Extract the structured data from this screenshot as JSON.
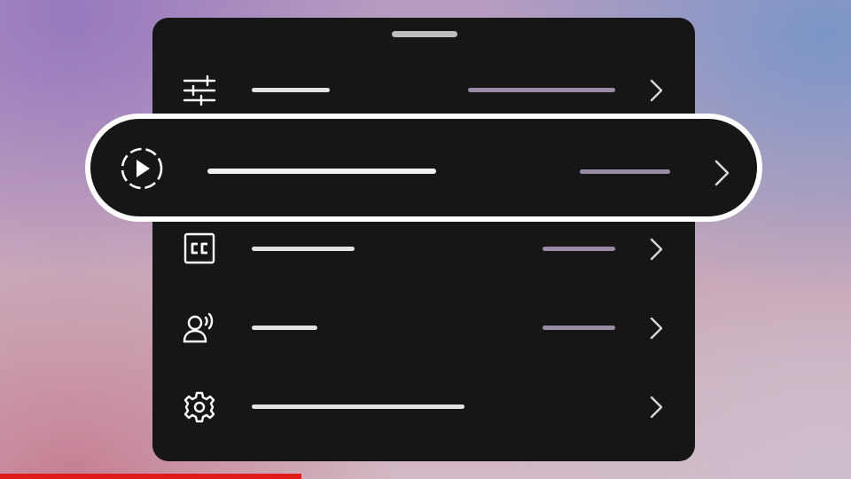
{
  "menu": {
    "colors": {
      "panel": "#161616",
      "label_bar": "#e2e2e2",
      "value_bar": "#9a8aa6",
      "icon": "#ffffff",
      "highlight_border": "#ffffff"
    },
    "items": [
      {
        "icon": "sliders-icon"
      },
      {
        "icon": "play-circle-dashed-icon",
        "selected": true
      },
      {
        "icon": "closed-captions-icon"
      },
      {
        "icon": "voice-speaker-icon"
      },
      {
        "icon": "gear-icon"
      }
    ]
  },
  "playback": {
    "progress_fraction": 0.354,
    "color": "#e01a1a"
  }
}
